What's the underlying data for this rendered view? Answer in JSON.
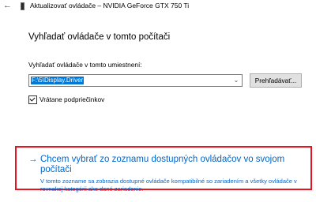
{
  "window": {
    "back_icon": "back-arrow-icon",
    "device_icon": "graphics-card-icon",
    "title": "Aktualizovať ovládače – NVIDIA GeForce GTX 750 Ti"
  },
  "page": {
    "heading": "Vyhľadať ovládače v tomto počítači"
  },
  "search": {
    "location_label": "Vyhľadať ovládače v tomto umiestnení:",
    "path_value": "F:\\5\\Display.Driver",
    "dropdown_icon": "chevron-down-icon",
    "browse_label": "Prehľadávať...",
    "include_subfolders_label": "Vrátane podpriečinkov",
    "include_subfolders_checked": true
  },
  "pick_option": {
    "arrow_icon": "arrow-right-icon",
    "title": "Chcem vybrať zo zoznamu dostupných ovládačov vo svojom počítači",
    "description": "V tomto zozname sa zobrazia dostupné ovládače kompatibilné so zariadením a všetky ovládače v rovnakej kategórii ako dané zariadenie.",
    "link_color": "#0066cc",
    "highlight_color": "#e8141e"
  }
}
